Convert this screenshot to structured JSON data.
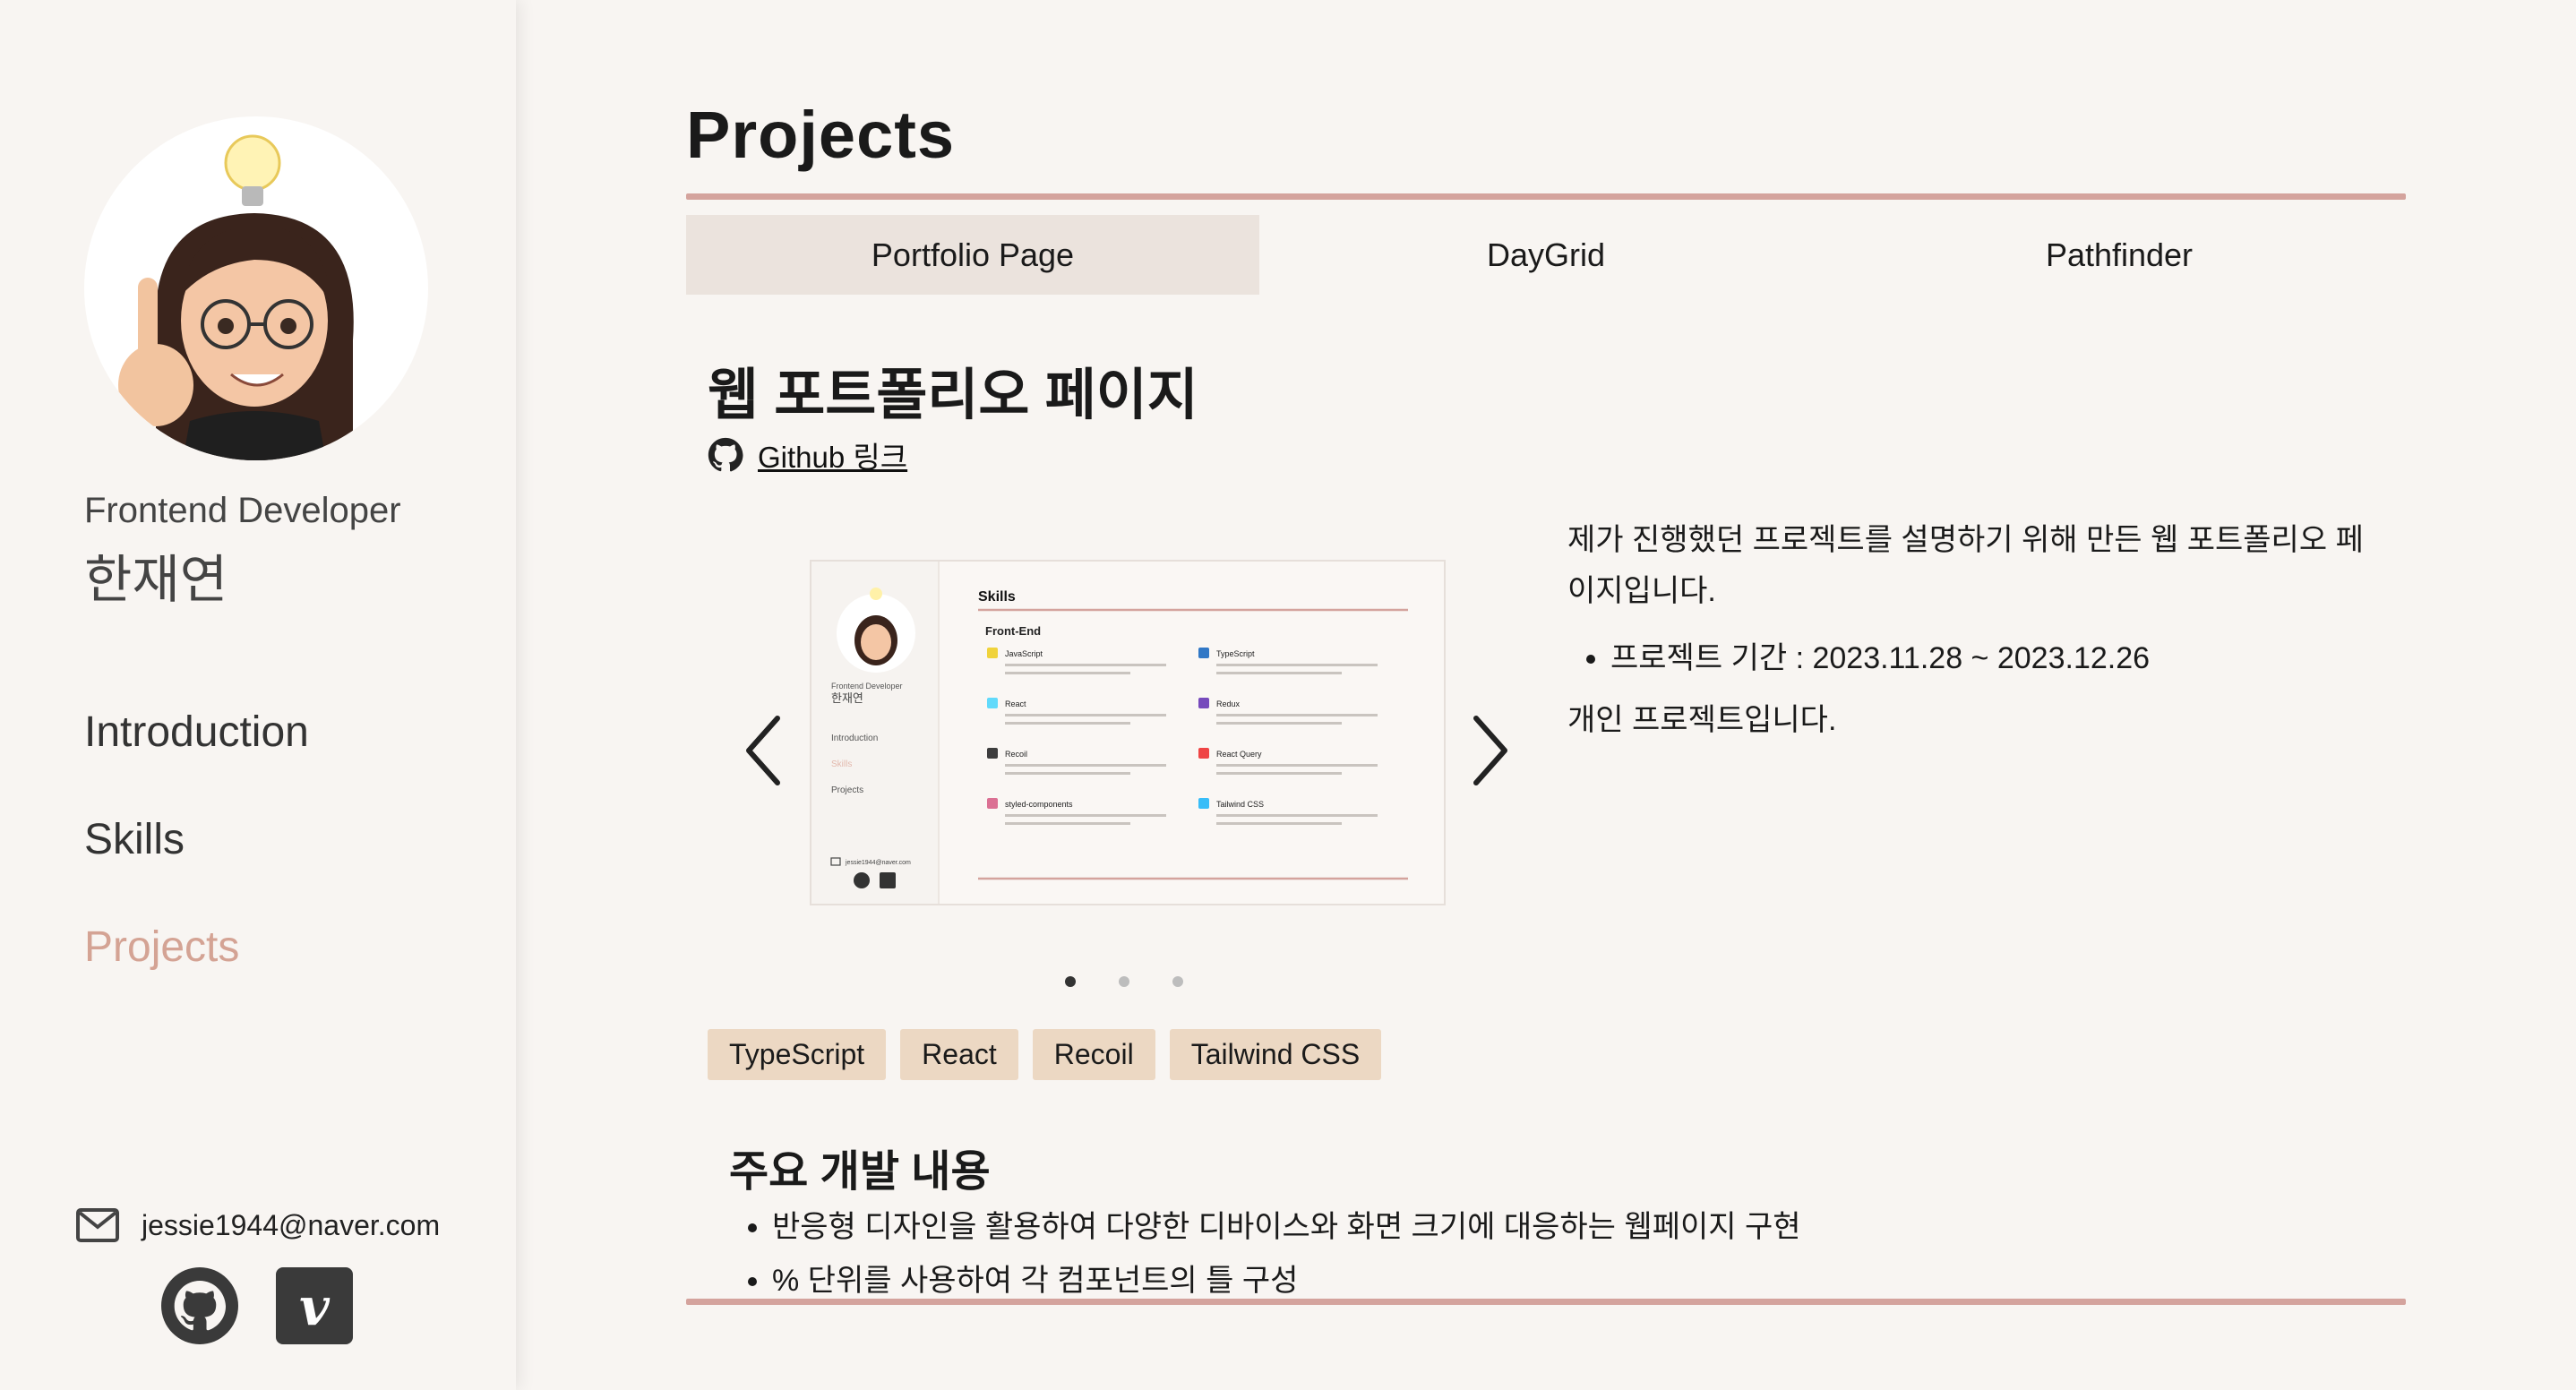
{
  "colors": {
    "background": "#f8f5f2",
    "accent": "#d4a39d",
    "active_nav": "#d4a394",
    "tab_active": "#ebe3dd",
    "tag_bg": "#ecd8c3"
  },
  "sidebar": {
    "role": "Frontend Developer",
    "name": "한재연",
    "nav": [
      {
        "label": "Introduction",
        "active": false
      },
      {
        "label": "Skills",
        "active": false
      },
      {
        "label": "Projects",
        "active": true
      }
    ],
    "email": "jessie1944@naver.com",
    "social_icons": [
      "github-icon",
      "velog-icon"
    ],
    "velog_glyph": "v"
  },
  "main": {
    "title": "Projects",
    "tabs": [
      {
        "label": "Portfolio Page",
        "active": true
      },
      {
        "label": "DayGrid",
        "active": false
      },
      {
        "label": "Pathfinder",
        "active": false
      }
    ],
    "project": {
      "title": "웹 포트폴리오 페이지",
      "github_label": "Github 링크",
      "description": "제가 진행했던 프로젝트를 설명하기 위해 만든 웹 포트폴리오 페이지입니다.",
      "period": "프로젝트 기간 : 2023.11.28 ~ 2023.12.26",
      "note": "개인 프로젝트입니다.",
      "tags": [
        "TypeScript",
        "React",
        "Recoil",
        "Tailwind CSS"
      ],
      "dev_title": "주요 개발 내용",
      "dev_items": [
        "반응형 디자인을 활용하여 다양한 디바이스와 화면 크기에 대응하는 웹페이지 구현",
        "% 단위를 사용하여 각 컴포넌트의 틀 구성"
      ]
    },
    "carousel": {
      "slide_count": 3,
      "active_index": 0,
      "slide": {
        "role": "Frontend Developer",
        "name": "한재연",
        "nav": [
          "Introduction",
          "Skills",
          "Projects"
        ],
        "email": "jessie1944@naver.com",
        "heading": "Skills",
        "subheading": "Front-End",
        "skills": [
          "JavaScript",
          "TypeScript",
          "React",
          "Redux",
          "Recoil",
          "React Query",
          "styled-components",
          "Tailwind CSS"
        ]
      }
    }
  }
}
